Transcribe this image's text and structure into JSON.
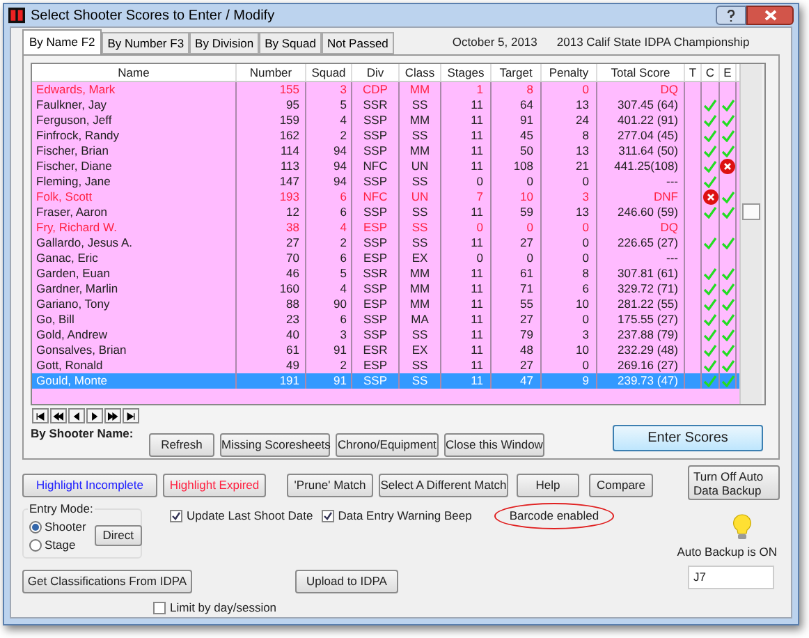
{
  "window": {
    "title": "Select Shooter Scores to Enter / Modify"
  },
  "tabs": [
    {
      "label": "By Name F2",
      "selected": true
    },
    {
      "label": "By Number F3",
      "selected": false
    },
    {
      "label": "By Division",
      "selected": false
    },
    {
      "label": "By Squad",
      "selected": false
    },
    {
      "label": "Not Passed",
      "selected": false
    }
  ],
  "header_info": {
    "date": "October  5, 2013",
    "match": "2013 Calif State IDPA Championship"
  },
  "table": {
    "columns": [
      "Name",
      "Number",
      "Squad",
      "Div",
      "Class",
      "Stages",
      "Target",
      "Penalty",
      "Total Score",
      "T",
      "C",
      "E"
    ],
    "rows": [
      {
        "cells": [
          "Edwards, Mark",
          "155",
          "3",
          "CDP",
          "MM",
          "1",
          "8",
          "0",
          "DQ"
        ],
        "flagged": true,
        "selected": false
      },
      {
        "cells": [
          "Faulkner, Jay",
          "95",
          "5",
          "SSR",
          "SS",
          "11",
          "64",
          "13",
          "307.45 (64)"
        ],
        "flagged": false,
        "selected": false,
        "c": true,
        "e": true
      },
      {
        "cells": [
          "Ferguson, Jeff",
          "159",
          "4",
          "SSP",
          "MM",
          "11",
          "91",
          "24",
          "401.22 (91)"
        ],
        "flagged": false,
        "selected": false,
        "c": true,
        "e": true
      },
      {
        "cells": [
          "Finfrock, Randy",
          "162",
          "2",
          "SSP",
          "SS",
          "11",
          "45",
          "8",
          "277.04 (45)"
        ],
        "flagged": false,
        "selected": false,
        "c": true,
        "e": true
      },
      {
        "cells": [
          "Fischer, Brian",
          "114",
          "94",
          "SSP",
          "MM",
          "11",
          "50",
          "13",
          "311.64 (50)"
        ],
        "flagged": false,
        "selected": false,
        "c": true,
        "e": true
      },
      {
        "cells": [
          "Fischer, Diane",
          "113",
          "94",
          "NFC",
          "UN",
          "11",
          "108",
          "21",
          "441.25(108)"
        ],
        "flagged": false,
        "selected": false,
        "c": true,
        "e": false
      },
      {
        "cells": [
          "Fleming, Jane",
          "147",
          "94",
          "SSP",
          "SS",
          "0",
          "0",
          "0",
          "---"
        ],
        "flagged": false,
        "selected": false,
        "c": true
      },
      {
        "cells": [
          "Folk, Scott",
          "193",
          "6",
          "NFC",
          "UN",
          "7",
          "10",
          "3",
          "DNF"
        ],
        "flagged": true,
        "selected": false,
        "c": false,
        "e": true
      },
      {
        "cells": [
          "Fraser, Aaron",
          "12",
          "6",
          "SSP",
          "SS",
          "11",
          "59",
          "13",
          "246.60 (59)"
        ],
        "flagged": false,
        "selected": false,
        "c": true,
        "e": true
      },
      {
        "cells": [
          "Fry, Richard W.",
          "38",
          "4",
          "ESP",
          "SS",
          "0",
          "0",
          "0",
          "DQ"
        ],
        "flagged": true,
        "selected": false
      },
      {
        "cells": [
          "Gallardo, Jesus A.",
          "27",
          "2",
          "SSP",
          "SS",
          "11",
          "27",
          "0",
          "226.65 (27)"
        ],
        "flagged": false,
        "selected": false,
        "c": true,
        "e": true
      },
      {
        "cells": [
          "Ganac, Eric",
          "70",
          "6",
          "ESP",
          "EX",
          "0",
          "0",
          "0",
          "---"
        ],
        "flagged": false,
        "selected": false
      },
      {
        "cells": [
          "Garden, Euan",
          "46",
          "5",
          "SSR",
          "MM",
          "11",
          "61",
          "8",
          "307.81 (61)"
        ],
        "flagged": false,
        "selected": false,
        "c": true,
        "e": true
      },
      {
        "cells": [
          "Gardner, Marlin",
          "160",
          "4",
          "SSP",
          "MM",
          "11",
          "71",
          "6",
          "329.72 (71)"
        ],
        "flagged": false,
        "selected": false,
        "c": true,
        "e": true
      },
      {
        "cells": [
          "Gariano, Tony",
          "88",
          "90",
          "ESP",
          "MM",
          "11",
          "55",
          "10",
          "281.22 (55)"
        ],
        "flagged": false,
        "selected": false,
        "c": true,
        "e": true
      },
      {
        "cells": [
          "Go, Bill",
          "23",
          "6",
          "SSP",
          "MA",
          "11",
          "27",
          "0",
          "175.55 (27)"
        ],
        "flagged": false,
        "selected": false,
        "c": true,
        "e": true
      },
      {
        "cells": [
          "Gold, Andrew",
          "40",
          "3",
          "SSP",
          "SS",
          "11",
          "79",
          "3",
          "237.88 (79)"
        ],
        "flagged": false,
        "selected": false,
        "c": true,
        "e": true
      },
      {
        "cells": [
          "Gonsalves, Brian",
          "61",
          "91",
          "ESR",
          "EX",
          "11",
          "48",
          "10",
          "232.29 (48)"
        ],
        "flagged": false,
        "selected": false,
        "c": true,
        "e": true
      },
      {
        "cells": [
          "Gott, Ronald",
          "49",
          "2",
          "ESP",
          "SS",
          "11",
          "27",
          "0",
          "269.16 (27)"
        ],
        "flagged": false,
        "selected": false,
        "c": true,
        "e": true
      },
      {
        "cells": [
          "Gould, Monte",
          "191",
          "91",
          "SSP",
          "SS",
          "11",
          "47",
          "9",
          "239.73 (47)"
        ],
        "flagged": false,
        "selected": true,
        "c": true,
        "e": true
      }
    ]
  },
  "filter_label": "By Shooter Name:",
  "list_buttons": [
    "Refresh",
    "Missing Scoresheets",
    "Chrono/Equipment",
    "Close this Window"
  ],
  "enter_button": "Enter Scores",
  "action_buttons": [
    {
      "label": "Highlight Incomplete",
      "color": "#2020ff"
    },
    {
      "label": "Highlight Expired",
      "color": "#ff2040"
    },
    {
      "label": "'Prune' Match"
    },
    {
      "label": "Select A Different  Match"
    },
    {
      "label": "Help"
    },
    {
      "label": "Compare"
    }
  ],
  "backup_button": "Turn Off Auto Data Backup",
  "entry_mode": {
    "label": "Entry Mode:",
    "options": [
      {
        "label": "Shooter",
        "selected": true
      },
      {
        "label": "Stage",
        "selected": false
      }
    ],
    "direct_button": "Direct"
  },
  "options": [
    {
      "label": "Update Last Shoot Date",
      "checked": true
    },
    {
      "label": "Data Entry Warning Beep",
      "checked": true
    }
  ],
  "barcode_label": "Barcode enabled",
  "auto_backup": {
    "status": "Auto Backup is ON",
    "on": true,
    "value": "J7"
  },
  "classifications_button": "Get Classifications From IDPA",
  "upload_button": "Upload to IDPA",
  "limit_option": {
    "label": "Limit by day/session",
    "checked": false
  }
}
